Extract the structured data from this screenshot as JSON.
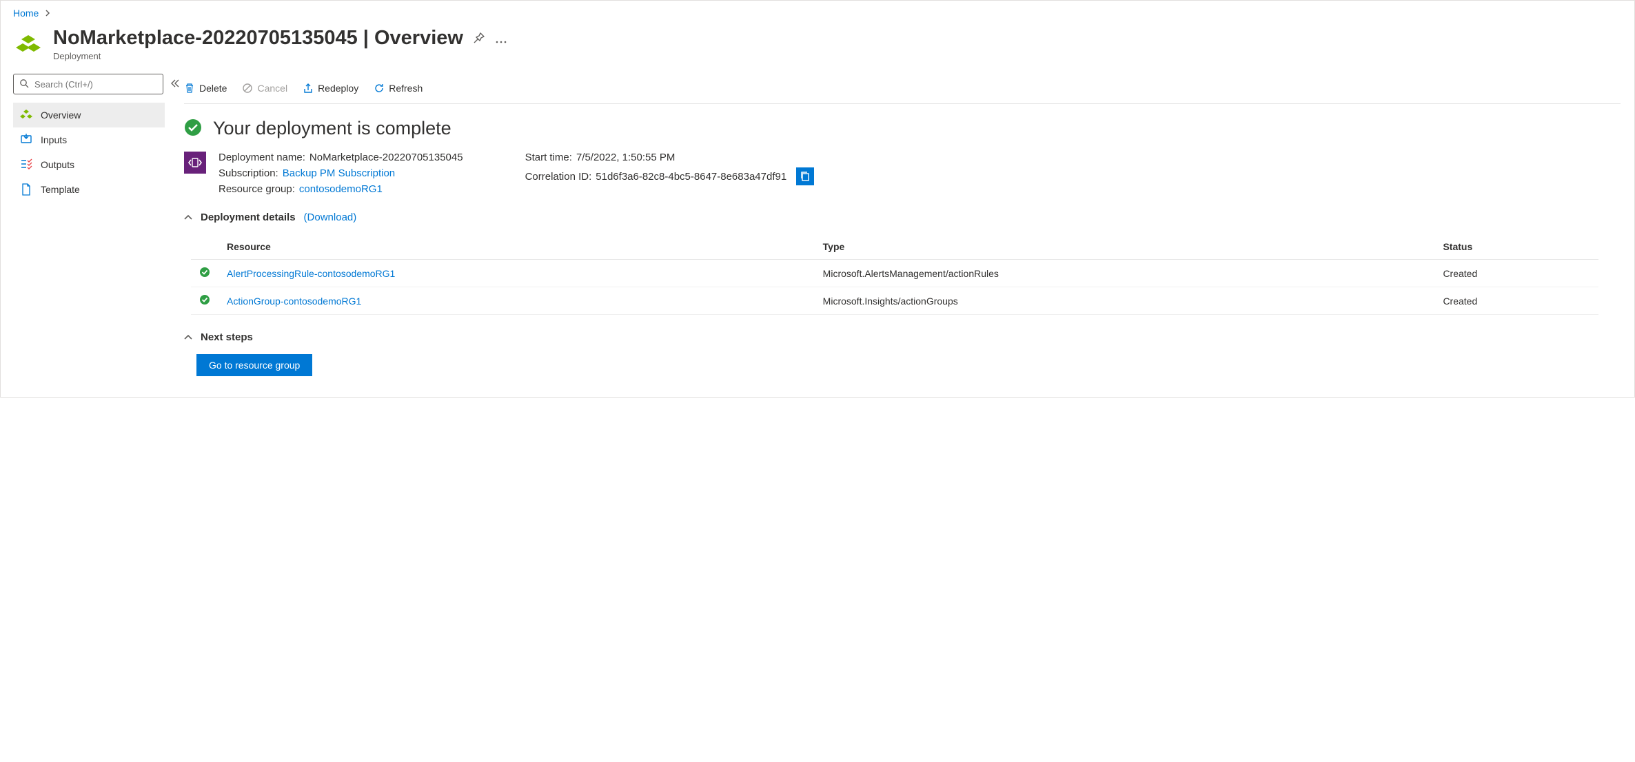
{
  "breadcrumb": {
    "home": "Home"
  },
  "header": {
    "title": "NoMarketplace-20220705135045 | Overview",
    "subtitle": "Deployment"
  },
  "sidebar": {
    "search_placeholder": "Search (Ctrl+/)",
    "items": [
      {
        "label": "Overview"
      },
      {
        "label": "Inputs"
      },
      {
        "label": "Outputs"
      },
      {
        "label": "Template"
      }
    ]
  },
  "toolbar": {
    "delete": "Delete",
    "cancel": "Cancel",
    "redeploy": "Redeploy",
    "refresh": "Refresh"
  },
  "status": {
    "title": "Your deployment is complete"
  },
  "info": {
    "left": {
      "dep_label": "Deployment name:",
      "dep_value": "NoMarketplace-20220705135045",
      "sub_label": "Subscription:",
      "sub_value": "Backup PM Subscription",
      "rg_label": "Resource group:",
      "rg_value": "contosodemoRG1"
    },
    "right": {
      "start_label": "Start time:",
      "start_value": "7/5/2022, 1:50:55 PM",
      "cor_label": "Correlation ID:",
      "cor_value": "51d6f3a6-82c8-4bc5-8647-8e683a47df91"
    }
  },
  "details": {
    "title": "Deployment details",
    "download": "(Download)",
    "headers": {
      "resource": "Resource",
      "type": "Type",
      "status": "Status"
    },
    "rows": [
      {
        "resource": "AlertProcessingRule-contosodemoRG1",
        "type": "Microsoft.AlertsManagement/actionRules",
        "status": "Created"
      },
      {
        "resource": "ActionGroup-contosodemoRG1",
        "type": "Microsoft.Insights/actionGroups",
        "status": "Created"
      }
    ]
  },
  "next": {
    "title": "Next steps",
    "button": "Go to resource group"
  }
}
